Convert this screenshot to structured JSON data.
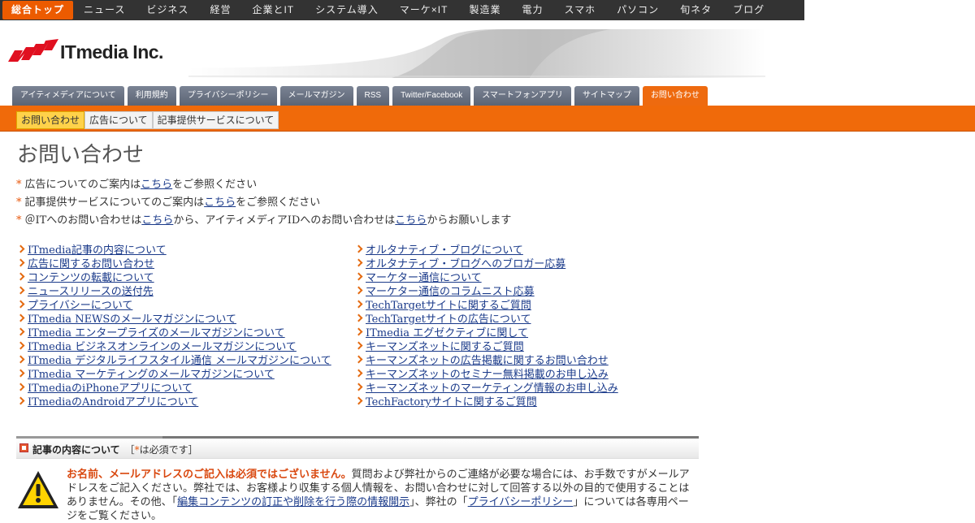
{
  "topnav": {
    "items": [
      "総合トップ",
      "ニュース",
      "ビジネス",
      "経営",
      "企業とIT",
      "システム導入",
      "マーケ×IT",
      "製造業",
      "電力",
      "スマホ",
      "パソコン",
      "旬ネタ",
      "ブログ"
    ]
  },
  "header": {
    "logo_text": "ITmedia Inc."
  },
  "tabs": [
    "アイティメディアについて",
    "利用規約",
    "プライバシーポリシー",
    "メールマガジン",
    "RSS",
    "Twitter/Facebook",
    "スマートフォンアプリ",
    "サイトマップ",
    "お問い合わせ"
  ],
  "subtabs": [
    "お問い合わせ",
    "広告について",
    "記事提供サービスについて"
  ],
  "page_title": "お問い合わせ",
  "notes": [
    {
      "pre": "広告についてのご案内は",
      "link": "こちら",
      "post": "をご参照ください"
    },
    {
      "pre": "記事提供サービスについてのご案内は",
      "link": "こちら",
      "post": "をご参照ください"
    },
    {
      "pre": "＠ITへのお問い合わせは",
      "link": "こちら",
      "mid": "から、アイティメディアIDへのお問い合わせは",
      "link2": "こちら",
      "post": "からお願いします"
    }
  ],
  "links_left": [
    "ITmedia記事の内容について",
    "広告に関するお問い合わせ",
    "コンテンツの転載について",
    "ニュースリリースの送付先",
    "プライバシーについて",
    "ITmedia NEWSのメールマガジンについて",
    "ITmedia エンタープライズのメールマガジンについて",
    "ITmedia ビジネスオンラインのメールマガジンについて",
    "ITmedia デジタルライフスタイル通信 メールマガジンについて",
    "ITmedia マーケティングのメールマガジンについて",
    "ITmediaのiPhoneアプリについて",
    "ITmediaのAndroidアプリについて"
  ],
  "links_right": [
    "オルタナティブ・ブログについて",
    "オルタナティブ・ブログへのブロガー応募",
    "マーケター通信について",
    "マーケター通信のコラムニスト応募",
    "TechTargetサイトに関するご質問",
    "TechTargetサイトの広告について",
    "ITmedia エグゼクティブに関して",
    "キーマンズネットに関するご質問",
    "キーマンズネットの広告掲載に関するお問い合わせ",
    "キーマンズネットのセミナー無料掲載のお申し込み",
    "キーマンズネットのマーケティング情報のお申し込み",
    "TechFactoryサイトに関するご質問"
  ],
  "section": {
    "title": "記事の内容について",
    "req_open": "［",
    "req_star": "*",
    "req_text": "は必須です］"
  },
  "warning": {
    "em": "お名前、メールアドレスのご記入は必須ではございません。",
    "text1": "質問および弊社からのご連絡が必要な場合には、お手数ですがメールアドレスをご記入ください。弊社では、お客様より収集する個人情報を、お問い合わせに対して回答する以外の目的で使用することはありません。その他、「",
    "link1": "編集コンテンツの訂正や削除を行う際の情報開示",
    "text2": "」、弊社の「",
    "link2": "プライバシーポリシー",
    "text3": "」については各専用ページをご覧ください。"
  },
  "colors": {
    "accent": "#f06a0a",
    "topnav_bg": "#333333",
    "tab_bg": "#6b7383",
    "link": "#1a3a8a"
  }
}
